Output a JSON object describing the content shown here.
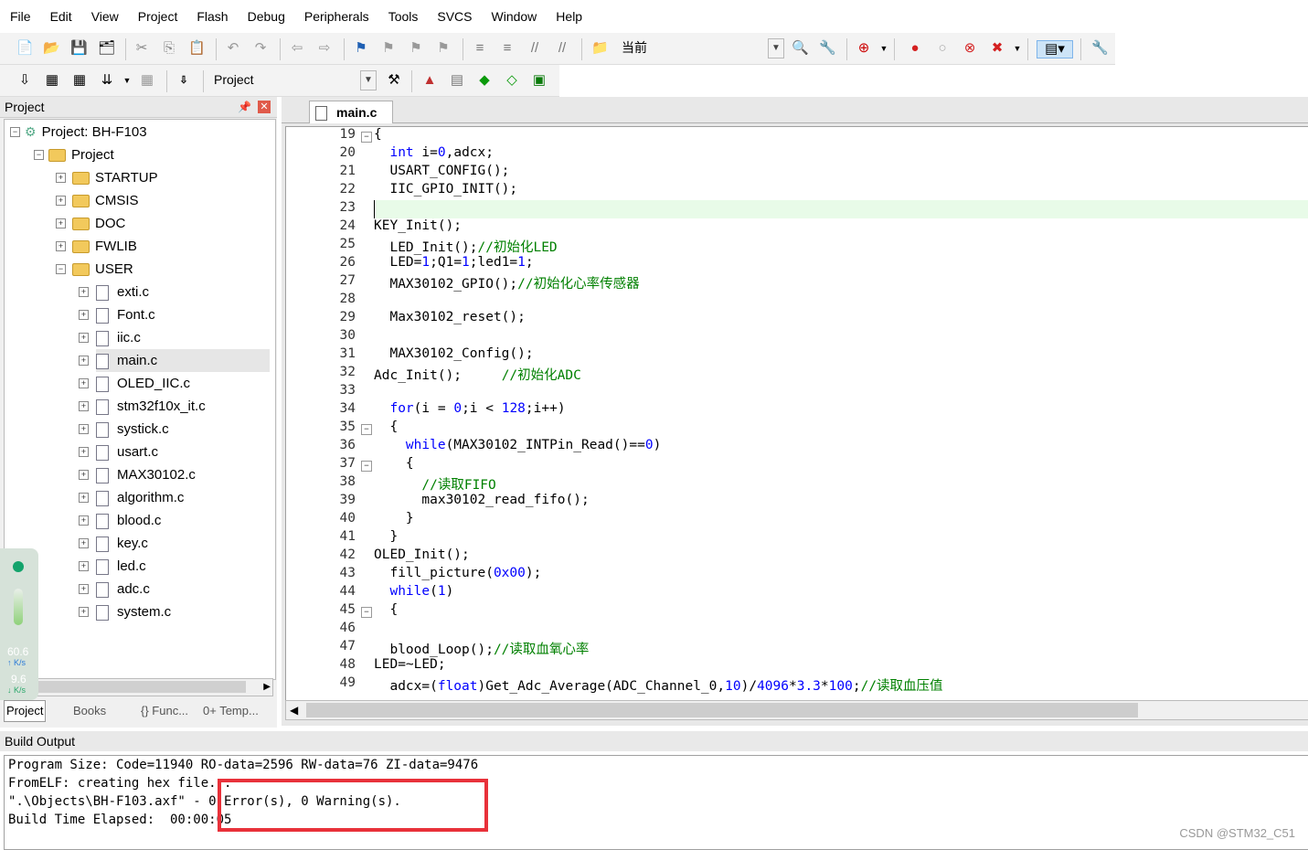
{
  "menu": [
    "File",
    "Edit",
    "View",
    "Project",
    "Flash",
    "Debug",
    "Peripherals",
    "Tools",
    "SVCS",
    "Window",
    "Help"
  ],
  "toolbar1": {
    "target_combo": "当前"
  },
  "toolbar2": {
    "project_combo": "Project"
  },
  "project_panel": {
    "title": "Project",
    "root": "Project: BH-F103",
    "group": "Project",
    "folders": [
      "STARTUP",
      "CMSIS",
      "DOC",
      "FWLIB",
      "USER"
    ],
    "files": [
      "exti.c",
      "Font.c",
      "iic.c",
      "main.c",
      "OLED_IIC.c",
      "stm32f10x_it.c",
      "systick.c",
      "usart.c",
      "MAX30102.c",
      "algorithm.c",
      "blood.c",
      "key.c",
      "led.c",
      "adc.c",
      "system.c"
    ],
    "tabs": [
      "Project",
      "Books",
      "{} Func...",
      "0+ Temp..."
    ]
  },
  "net_widget": {
    "up": "60.6",
    "up_unit": "K/s",
    "down": "9.6",
    "down_unit": "K/s"
  },
  "editor": {
    "tab": "main.c",
    "lines": [
      {
        "n": "19",
        "t": "{"
      },
      {
        "n": "20",
        "t": "  int i=0,adcx;"
      },
      {
        "n": "21",
        "t": "  USART_CONFIG();"
      },
      {
        "n": "22",
        "t": "  IIC_GPIO_INIT();"
      },
      {
        "n": "23",
        "t": ""
      },
      {
        "n": "24",
        "t": "KEY_Init();"
      },
      {
        "n": "25",
        "t": "  LED_Init();//初始化LED"
      },
      {
        "n": "26",
        "t": "  LED=1;Q1=1;led1=1;"
      },
      {
        "n": "27",
        "t": "  MAX30102_GPIO();//初始化心率传感器"
      },
      {
        "n": "28",
        "t": ""
      },
      {
        "n": "29",
        "t": "  Max30102_reset();"
      },
      {
        "n": "30",
        "t": ""
      },
      {
        "n": "31",
        "t": "  MAX30102_Config();"
      },
      {
        "n": "32",
        "t": "Adc_Init();     //初始化ADC"
      },
      {
        "n": "33",
        "t": ""
      },
      {
        "n": "34",
        "t": "  for(i = 0;i < 128;i++)"
      },
      {
        "n": "35",
        "t": "  {"
      },
      {
        "n": "36",
        "t": "    while(MAX30102_INTPin_Read()==0)"
      },
      {
        "n": "37",
        "t": "    {"
      },
      {
        "n": "38",
        "t": "      //读取FIFO"
      },
      {
        "n": "39",
        "t": "      max30102_read_fifo();"
      },
      {
        "n": "40",
        "t": "    }"
      },
      {
        "n": "41",
        "t": "  }"
      },
      {
        "n": "42",
        "t": "OLED_Init();"
      },
      {
        "n": "43",
        "t": "  fill_picture(0x00);"
      },
      {
        "n": "44",
        "t": "  while(1)"
      },
      {
        "n": "45",
        "t": "  {"
      },
      {
        "n": "46",
        "t": ""
      },
      {
        "n": "47",
        "t": "  blood_Loop();//读取血氧心率"
      },
      {
        "n": "48",
        "t": "LED=~LED;"
      },
      {
        "n": "49",
        "t": "  adcx=(float)Get_Adc_Average(ADC_Channel_0,10)/4096*3.3*100;//读取血压值"
      }
    ]
  },
  "build_output": {
    "title": "Build Output",
    "lines": [
      "Program Size: Code=11940 RO-data=2596 RW-data=76 ZI-data=9476",
      "FromELF: creating hex file...",
      "\".\\Objects\\BH-F103.axf\" - 0 Error(s), 0 Warning(s).",
      "Build Time Elapsed:  00:00:05"
    ]
  },
  "watermark": "CSDN @STM32_C51",
  "colors": {
    "highlight_box": "#e8313a",
    "current_line": "#e8fbe8",
    "keyword": "#0000ff",
    "comment": "#008000"
  }
}
